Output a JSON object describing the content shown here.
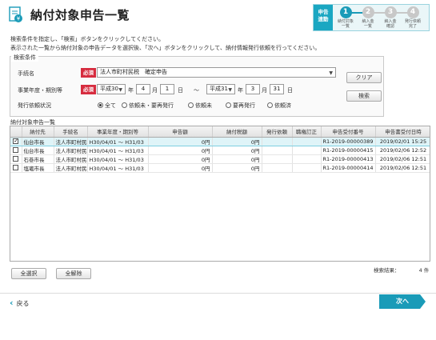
{
  "header": {
    "title": "納付対象申告一覧",
    "logo_icon": "document-yen-icon",
    "steps_current_label": "申告\n連動",
    "steps": [
      {
        "num": "1",
        "label": "納付対象\n一覧",
        "active": true
      },
      {
        "num": "2",
        "label": "納入金\n一覧",
        "active": false
      },
      {
        "num": "3",
        "label": "納入金\n確認",
        "active": false
      },
      {
        "num": "4",
        "label": "発行依頼\n完了",
        "active": false
      }
    ]
  },
  "instructions": {
    "line1": "検索条件を指定し、「検索」ボタンをクリックしてください。",
    "line2": "表示された一覧から納付対象の申告データを選択後、「次へ」ボタンをクリックして、納付情報発行依頼を行ってください。"
  },
  "search": {
    "panel_title": "検索条件",
    "procedure_label": "手続名",
    "required": "必須",
    "procedure_value": "法人市町村民税　確定申告",
    "period_label": "事業年度・期別等",
    "from_era": "平成30",
    "from_year": "4",
    "from_month": "1",
    "from_day": "",
    "to_era": "平成31",
    "to_year": "3",
    "to_month": "31",
    "unit_year": "年",
    "unit_month": "月",
    "unit_day": "日",
    "tilde": "～",
    "status_label": "発行依頼状況",
    "status_options": [
      "全て",
      "依頼未・要再発行",
      "依頼未",
      "要再発行",
      "依頼済"
    ],
    "status_selected": 0,
    "clear_label": "クリア",
    "search_label": "検索"
  },
  "list": {
    "title": "納付対象申告一覧",
    "columns": [
      "",
      "納付先",
      "手続名",
      "事業年度・期別等",
      "申告額",
      "納付税額",
      "発行依頼",
      "職権訂正",
      "申告受付番号",
      "申告書受付日時"
    ],
    "rows": [
      {
        "checked": true,
        "dest": "仙台市長",
        "proc": "法人市町村民税",
        "period": "H30/04/01 ～ H31/03",
        "amount": "0円",
        "tax": "0円",
        "request": "",
        "correction": "",
        "receipt_no": "R1-2019-00000389",
        "received_at": "2019/02/01 15:25"
      },
      {
        "checked": false,
        "dest": "仙台市長",
        "proc": "法人市町村民税",
        "period": "H30/04/01 ～ H31/03",
        "amount": "0円",
        "tax": "0円",
        "request": "",
        "correction": "",
        "receipt_no": "R1-2019-00000415",
        "received_at": "2019/02/06 12:52"
      },
      {
        "checked": false,
        "dest": "石巻市長",
        "proc": "法人市町村民税",
        "period": "H30/04/01 ～ H31/03",
        "amount": "0円",
        "tax": "0円",
        "request": "",
        "correction": "",
        "receipt_no": "R1-2019-00000413",
        "received_at": "2019/02/06 12:51"
      },
      {
        "checked": false,
        "dest": "塩竈市長",
        "proc": "法人市町村民税",
        "period": "H30/04/01 ～ H31/03",
        "amount": "0円",
        "tax": "0円",
        "request": "",
        "correction": "",
        "receipt_no": "R1-2019-00000414",
        "received_at": "2019/02/06 12:51"
      }
    ],
    "select_all_label": "全選択",
    "deselect_all_label": "全解除",
    "result_count_label": "検索結果：",
    "result_count_value": "4 件"
  },
  "footer": {
    "back_label": "戻る",
    "next_label": "次へ"
  },
  "colors": {
    "accent": "#1a9bb8",
    "required": "#d62c3f",
    "selected_row": "#dff4f8"
  }
}
